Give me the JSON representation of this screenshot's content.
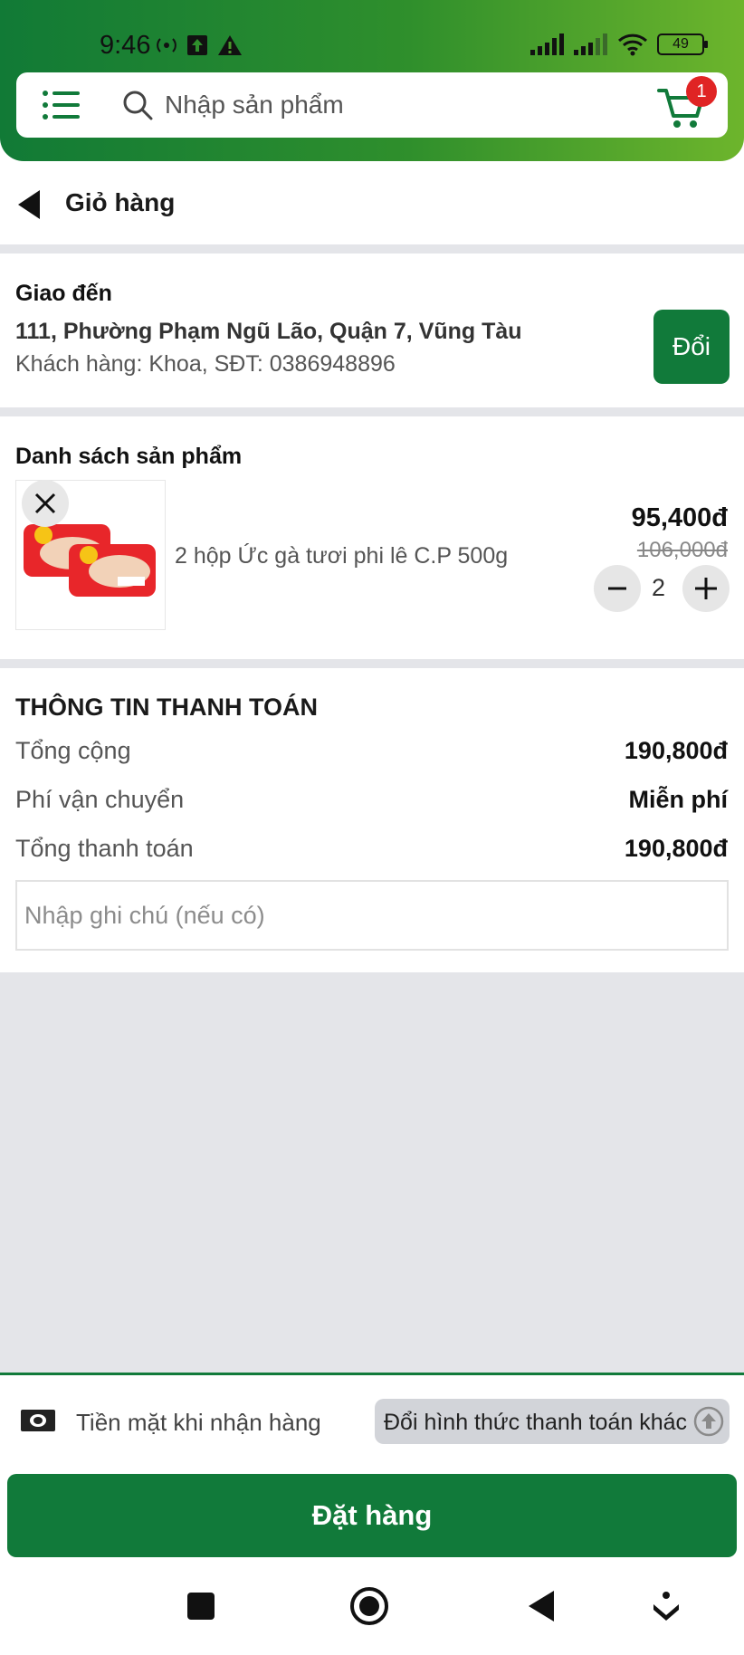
{
  "status_bar": {
    "time": "9:46",
    "battery": "49"
  },
  "search": {
    "placeholder": "Nhập sản phẩm"
  },
  "cart": {
    "badge_count": "1"
  },
  "page": {
    "title": "Giỏ hàng"
  },
  "delivery": {
    "section_label": "Giao đến",
    "address": "111, Phường Phạm Ngũ Lão, Quận 7, Vũng Tàu",
    "customer": "Khách hàng: Khoa, SĐT: 0386948896",
    "change_label": "Đổi"
  },
  "products": {
    "section_label": "Danh sách sản phẩm",
    "items": [
      {
        "name": "2 hộp Ức gà tươi phi lê C.P 500g",
        "price": "95,400đ",
        "old_price": "106,000đ",
        "quantity": "2"
      }
    ]
  },
  "payment_info": {
    "title": "THÔNG TIN THANH TOÁN",
    "rows": [
      {
        "label": "Tổng cộng",
        "value": "190,800đ"
      },
      {
        "label": "Phí vận chuyển",
        "value": "Miễn phí"
      },
      {
        "label": "Tổng thanh toán",
        "value": "190,800đ"
      }
    ],
    "note_placeholder": "Nhập ghi chú (nếu có)"
  },
  "payment_method": {
    "current": "Tiền mặt khi nhận hàng",
    "change_label": "Đổi hình thức thanh toán khác"
  },
  "order_button": {
    "label": "Đặt hàng"
  },
  "colors": {
    "primary": "#117a3a",
    "badge": "#e02424",
    "gray_bg": "#e4e5e9"
  }
}
